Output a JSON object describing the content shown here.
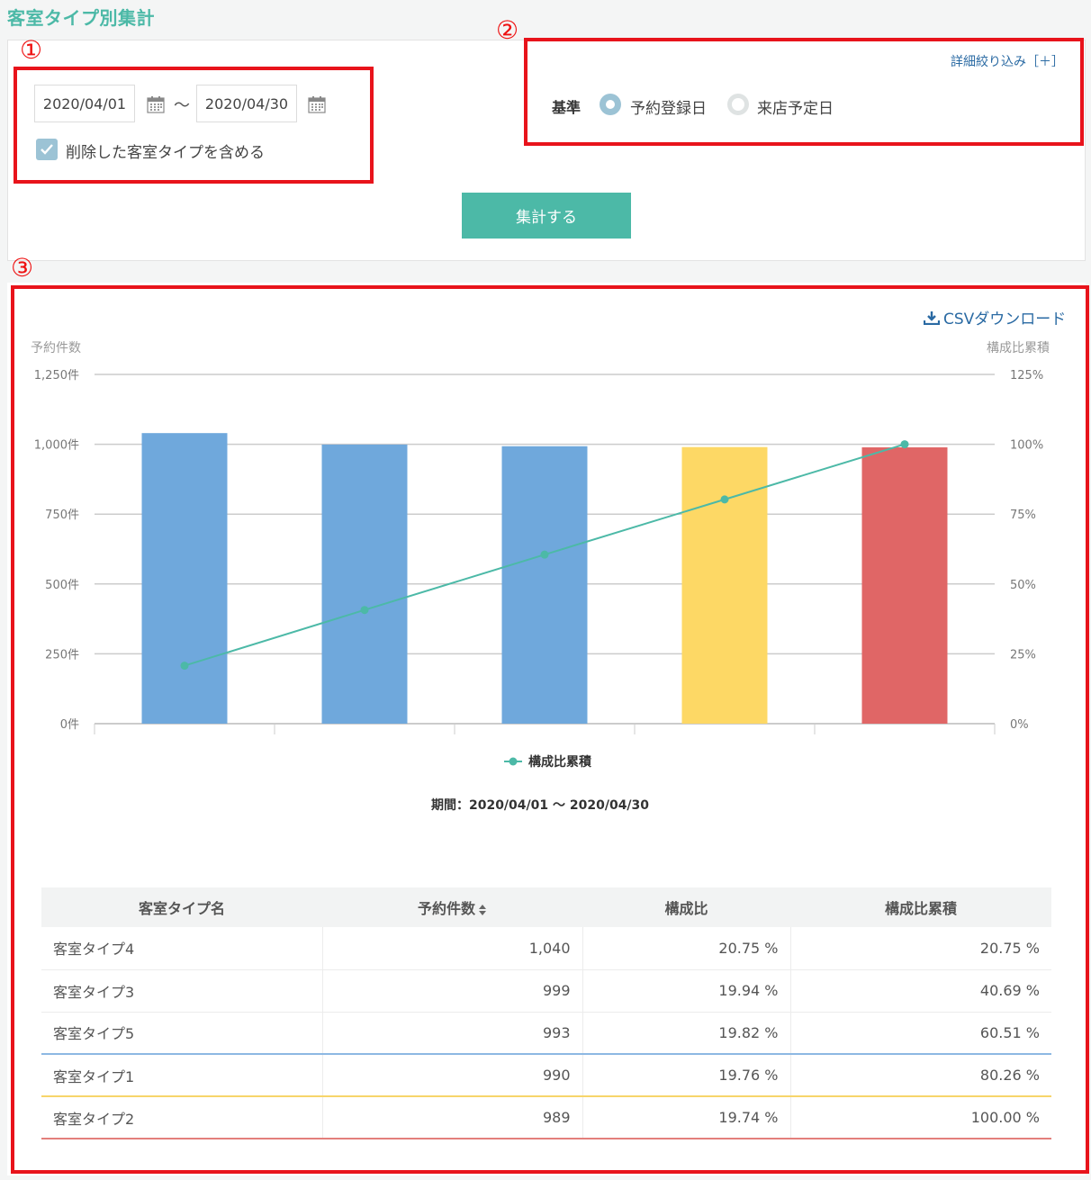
{
  "page_title": "客室タイプ別集計",
  "callouts": [
    "①",
    "②",
    "③"
  ],
  "filter": {
    "date_from": "2020/04/01",
    "date_to": "2020/04/30",
    "range_sep": "～",
    "include_deleted_label": "削除した客室タイプを含める",
    "include_deleted_checked": true,
    "detail_link": "詳細絞り込み［＋］",
    "basis_label": "基準",
    "basis_options": [
      "予約登録日",
      "来店予定日"
    ],
    "basis_selected": "予約登録日",
    "submit_label": "集計する"
  },
  "csv_download_label": "CSVダウンロード",
  "chart_data": {
    "type": "bar",
    "categories": [
      "",
      "",
      "",
      "",
      ""
    ],
    "bar_colors": [
      "#6fa8dc",
      "#6fa8dc",
      "#6fa8dc",
      "#fdd865",
      "#e06666"
    ],
    "line_color": "#4cb9a7",
    "series": [
      {
        "name": "予約件数",
        "type": "bar",
        "axis": "left",
        "values": [
          1040,
          999,
          993,
          990,
          989
        ]
      },
      {
        "name": "構成比累積",
        "type": "line",
        "axis": "right",
        "values": [
          20.75,
          40.69,
          60.51,
          80.26,
          100.0
        ]
      }
    ],
    "ylabel_left": "予約件数",
    "ylabel_right": "構成比累積",
    "ylim_left": [
      0,
      1250
    ],
    "ylim_right": [
      0,
      125
    ],
    "yticks_left": [
      "0件",
      "250件",
      "500件",
      "750件",
      "1,000件",
      "1,250件"
    ],
    "yticks_right": [
      "0%",
      "25%",
      "50%",
      "75%",
      "100%",
      "125%"
    ],
    "tick_values_left": [
      0,
      250,
      500,
      750,
      1000,
      1250
    ],
    "legend": "構成比累積",
    "legend_position": "bottom",
    "period_caption": "期間：2020/04/01 ～ 2020/04/30",
    "grid": true
  },
  "table": {
    "headers": [
      "客室タイプ名",
      "予約件数",
      "構成比",
      "構成比累積"
    ],
    "rows": [
      {
        "name": "客室タイプ4",
        "count": "1,040",
        "ratio": "20.75 %",
        "cumulative": "20.75 %"
      },
      {
        "name": "客室タイプ3",
        "count": "999",
        "ratio": "19.94 %",
        "cumulative": "40.69 %"
      },
      {
        "name": "客室タイプ5",
        "count": "993",
        "ratio": "19.82 %",
        "cumulative": "60.51 %"
      },
      {
        "name": "客室タイプ1",
        "count": "990",
        "ratio": "19.76 %",
        "cumulative": "80.26 %"
      },
      {
        "name": "客室タイプ2",
        "count": "989",
        "ratio": "19.74 %",
        "cumulative": "100.00 %"
      }
    ]
  }
}
